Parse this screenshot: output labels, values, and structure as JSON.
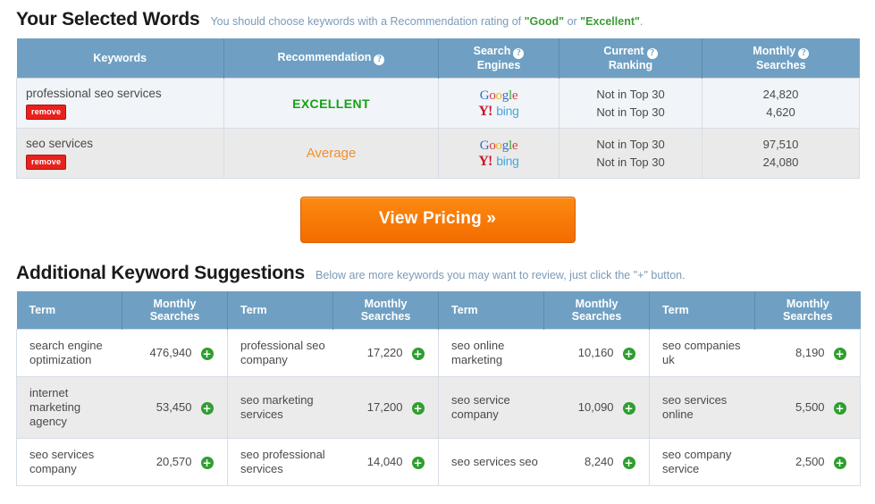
{
  "selected": {
    "title": "Your Selected Words",
    "subtitle_pre": "You should choose keywords with a Recommendation rating of ",
    "subtitle_good": "\"Good\"",
    "subtitle_mid": " or ",
    "subtitle_excellent": "\"Excellent\"",
    "subtitle_end": ".",
    "headers": {
      "keywords": "Keywords",
      "recommendation": "Recommendation",
      "search_engines_l1": "Search",
      "search_engines_l2": "Engines",
      "current_ranking_l1": "Current",
      "current_ranking_l2": "Ranking",
      "monthly_searches_l1": "Monthly",
      "monthly_searches_l2": "Searches",
      "help_glyph": "?"
    },
    "rows": [
      {
        "keyword": "professional seo services",
        "remove_label": "remove",
        "recommendation": "EXCELLENT",
        "engines": {
          "google": "Google",
          "yahoo": "Y!",
          "bing": "bing"
        },
        "ranking_google": "Not in Top 30",
        "ranking_other": "Not in Top 30",
        "searches_google": "24,820",
        "searches_other": "4,620"
      },
      {
        "keyword": "seo services",
        "remove_label": "remove",
        "recommendation": "Average",
        "engines": {
          "google": "Google",
          "yahoo": "Y!",
          "bing": "bing"
        },
        "ranking_google": "Not in Top 30",
        "ranking_other": "Not in Top 30",
        "searches_google": "97,510",
        "searches_other": "24,080"
      }
    ]
  },
  "cta": {
    "label": "View Pricing »"
  },
  "suggestions": {
    "title": "Additional Keyword Suggestions",
    "subtitle": "Below are more keywords you may want to review, just click the \"+\" button.",
    "headers": {
      "term": "Term",
      "monthly_l1": "Monthly",
      "monthly_l2": "Searches"
    },
    "add_glyph": "+",
    "rows": [
      [
        {
          "term": "search engine optimization",
          "value": "476,940"
        },
        {
          "term": "professional seo company",
          "value": "17,220"
        },
        {
          "term": "seo online marketing",
          "value": "10,160"
        },
        {
          "term": "seo companies uk",
          "value": "8,190"
        }
      ],
      [
        {
          "term": "internet marketing agency",
          "value": "53,450"
        },
        {
          "term": "seo marketing services",
          "value": "17,200"
        },
        {
          "term": "seo service company",
          "value": "10,090"
        },
        {
          "term": "seo services online",
          "value": "5,500"
        }
      ],
      [
        {
          "term": "seo services company",
          "value": "20,570"
        },
        {
          "term": "seo professional services",
          "value": "14,040"
        },
        {
          "term": "seo services seo",
          "value": "8,240"
        },
        {
          "term": "seo company service",
          "value": "2,500"
        }
      ]
    ]
  },
  "colors": {
    "header_blue": "#6fa0c3",
    "accent_orange": "#f36c01",
    "good_green": "#3d9b35",
    "excellent_green": "#17a117",
    "average_orange": "#f09030",
    "remove_red": "#e8211c",
    "add_green": "#2f9e2f",
    "sub_text_blue": "#7b9ab8"
  }
}
